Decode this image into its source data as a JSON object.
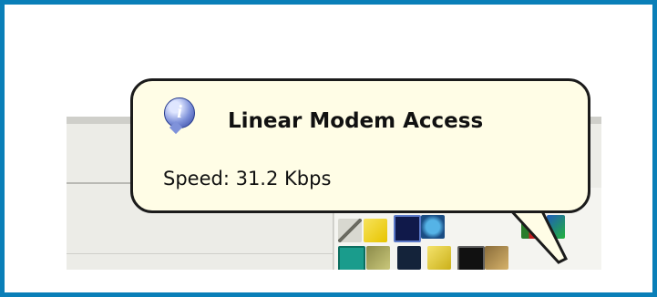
{
  "balloon": {
    "icon": "info-icon",
    "title": "Linear Modem Access",
    "message": "Speed: 31.2 Kbps"
  },
  "tray": {
    "icons": [
      "network-icon",
      "security-icon",
      "monitor-icon",
      "globe-icon",
      "windows-flag-icon",
      "connection-icon",
      "modem-icon",
      "display-settings-icon",
      "network-computers-icon",
      "envelope-icon",
      "modem-status-icon",
      "app-icon"
    ]
  },
  "colors": {
    "frame_border": "#0a7fb8",
    "balloon_bg": "#fffde6",
    "balloon_border": "#1b1b1b",
    "taskbar_bg": "#ececE7"
  }
}
